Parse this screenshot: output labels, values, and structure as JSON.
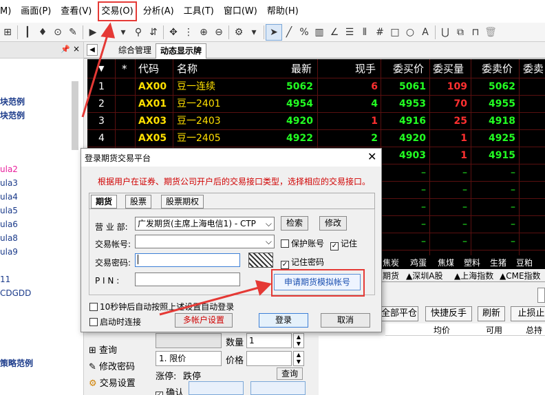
{
  "menubar": {
    "items": [
      {
        "label": "M)"
      },
      {
        "label": "画面(P)"
      },
      {
        "label": "查看(V)"
      },
      {
        "label": "交易(O)"
      },
      {
        "label": "分析(A)"
      },
      {
        "label": "工具(T)"
      },
      {
        "label": "窗口(W)"
      },
      {
        "label": "帮助(H)"
      }
    ],
    "highlight_color": "#e53935"
  },
  "left_panel": {
    "items": [
      {
        "label": "块范例"
      },
      {
        "label": "块范例"
      },
      {
        "label": "ula2"
      },
      {
        "label": "ula3"
      },
      {
        "label": "ula4"
      },
      {
        "label": "ula5"
      },
      {
        "label": "ula6"
      },
      {
        "label": "ula8"
      },
      {
        "label": "ula9"
      },
      {
        "label": "11"
      },
      {
        "label": "CDGDD"
      },
      {
        "label": "策略范例"
      }
    ]
  },
  "tabs": [
    {
      "label": "综合管理"
    },
    {
      "label": "动态显示牌"
    }
  ],
  "board": {
    "headers": [
      "▼",
      "*",
      "代码",
      "名称",
      "最新",
      "现手",
      "委买价",
      "委买量",
      "委卖价",
      "委卖"
    ],
    "rows": [
      {
        "idx": "1",
        "code": "AX00",
        "name": "豆一连续",
        "last": "5062",
        "vol": "6",
        "bid": "5061",
        "bidq": "109",
        "ask": "5062"
      },
      {
        "idx": "2",
        "code": "AX01",
        "name": "豆一2401",
        "last": "4954",
        "vol": "4",
        "bid": "4953",
        "bidq": "70",
        "ask": "4955"
      },
      {
        "idx": "3",
        "code": "AX03",
        "name": "豆一2403",
        "last": "4920",
        "vol": "1",
        "bid": "4916",
        "bidq": "25",
        "ask": "4918"
      },
      {
        "idx": "4",
        "code": "AX05",
        "name": "豆一2405",
        "last": "4922",
        "vol": "2",
        "bid": "4920",
        "bidq": "1",
        "ask": "4925"
      },
      {
        "idx": "",
        "code": "",
        "name": "",
        "last": "",
        "vol": "",
        "bid": "4903",
        "bidq": "1",
        "ask": "4915"
      },
      {
        "idx": "",
        "code": "",
        "name": "",
        "last": "",
        "vol": "",
        "bid": "–",
        "bidq": "–",
        "ask": "–"
      },
      {
        "idx": "",
        "code": "",
        "name": "",
        "last": "",
        "vol": "",
        "bid": "–",
        "bidq": "–",
        "ask": "–"
      },
      {
        "idx": "",
        "code": "",
        "name": "",
        "last": "",
        "vol": "",
        "bid": "–",
        "bidq": "–",
        "ask": "–"
      },
      {
        "idx": "",
        "code": "",
        "name": "",
        "last": "",
        "vol": "",
        "bid": "–",
        "bidq": "–",
        "ask": "–"
      },
      {
        "idx": "",
        "code": "",
        "name": "",
        "last": "",
        "vol": "",
        "bid": "–",
        "bidq": "–",
        "ask": "–"
      }
    ]
  },
  "categories": [
    "焦炭",
    "鸡蛋",
    "焦煤",
    "塑料",
    "生猪",
    "豆粕"
  ],
  "exchanges": [
    "期货",
    "▲深圳A股",
    "▲上海指数",
    "▲CME指数"
  ],
  "trade_buttons": [
    "全部平仓",
    "快捷反手",
    "刷新",
    "止损止"
  ],
  "grid_headers": [
    "均价",
    "可用",
    "总持"
  ],
  "order_panel": {
    "items": [
      "查询",
      "修改密码",
      "交易设置"
    ],
    "qty_label": "数量",
    "qty_value": "1",
    "price_type": "1. 限价",
    "price_label": "价格",
    "limit_label": "涨停:",
    "limit_down_label": "跌停",
    "query_button": "查询",
    "confirm_label": "确认"
  },
  "dialog": {
    "title": "登录期货交易平台",
    "hint": "根据用户在证券、期货公司开户后的交易接口类型，选择相应的交易接口。",
    "tabs": [
      "期货",
      "股票",
      "股票期权"
    ],
    "business_label": "营 业 部:",
    "business_value": "广发期货(主席上海电信1) - CTP",
    "search_button": "检索",
    "modify_button": "修改",
    "account_label": "交易帐号:",
    "account_value": "",
    "protect_label": "保护账号",
    "remember_label": "记住",
    "password_label": "交易密码:",
    "remember_pw_label": "记住密码",
    "pin_label": "P I N :",
    "apply_button": "申请期货模拟帐号",
    "auto_login_label": "10秒钟后自动按照上述设置自动登录",
    "startup_label": "启动时连接",
    "multi_account_button": "多帐户设置",
    "login_button": "登录",
    "cancel_button": "取消"
  }
}
